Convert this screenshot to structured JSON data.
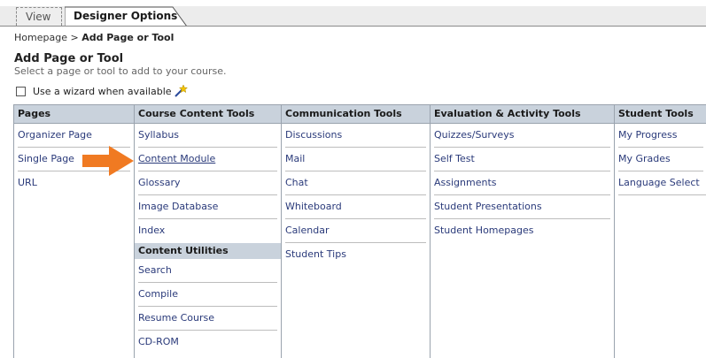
{
  "tabs": {
    "view_label": "View",
    "designer_label": "Designer Options"
  },
  "breadcrumb": {
    "home": "Homepage",
    "separator": ">",
    "current": "Add Page or Tool"
  },
  "page": {
    "title": "Add Page or Tool",
    "subtitle": "Select a page or tool to add to your course."
  },
  "wizard": {
    "label": "Use a wizard when available",
    "checked": false
  },
  "columns": {
    "pages": {
      "header": "Pages",
      "items": [
        "Organizer Page",
        "Single Page",
        "URL"
      ]
    },
    "course_content": {
      "header": "Course Content Tools",
      "items": [
        "Syllabus",
        "Content Module",
        "Glossary",
        "Image Database",
        "Index"
      ],
      "subheader": "Content Utilities",
      "sub_items": [
        "Search",
        "Compile",
        "Resume Course",
        "CD-ROM"
      ]
    },
    "communication": {
      "header": "Communication Tools",
      "items": [
        "Discussions",
        "Mail",
        "Chat",
        "Whiteboard",
        "Calendar",
        "Student Tips"
      ]
    },
    "evaluation": {
      "header": "Evaluation & Activity Tools",
      "items": [
        "Quizzes/Surveys",
        "Self Test",
        "Assignments",
        "Student Presentations",
        "Student Homepages"
      ]
    },
    "student": {
      "header": "Student Tools",
      "items": [
        "My Progress",
        "My Grades",
        "Language Select"
      ]
    }
  },
  "colors": {
    "header_bg": "#c9d2dc",
    "link_text": "#2a3a7a",
    "arrow": "#f07a22"
  },
  "icons": {
    "wizard": "magic-wand-icon",
    "pointer": "orange-arrow-icon"
  }
}
